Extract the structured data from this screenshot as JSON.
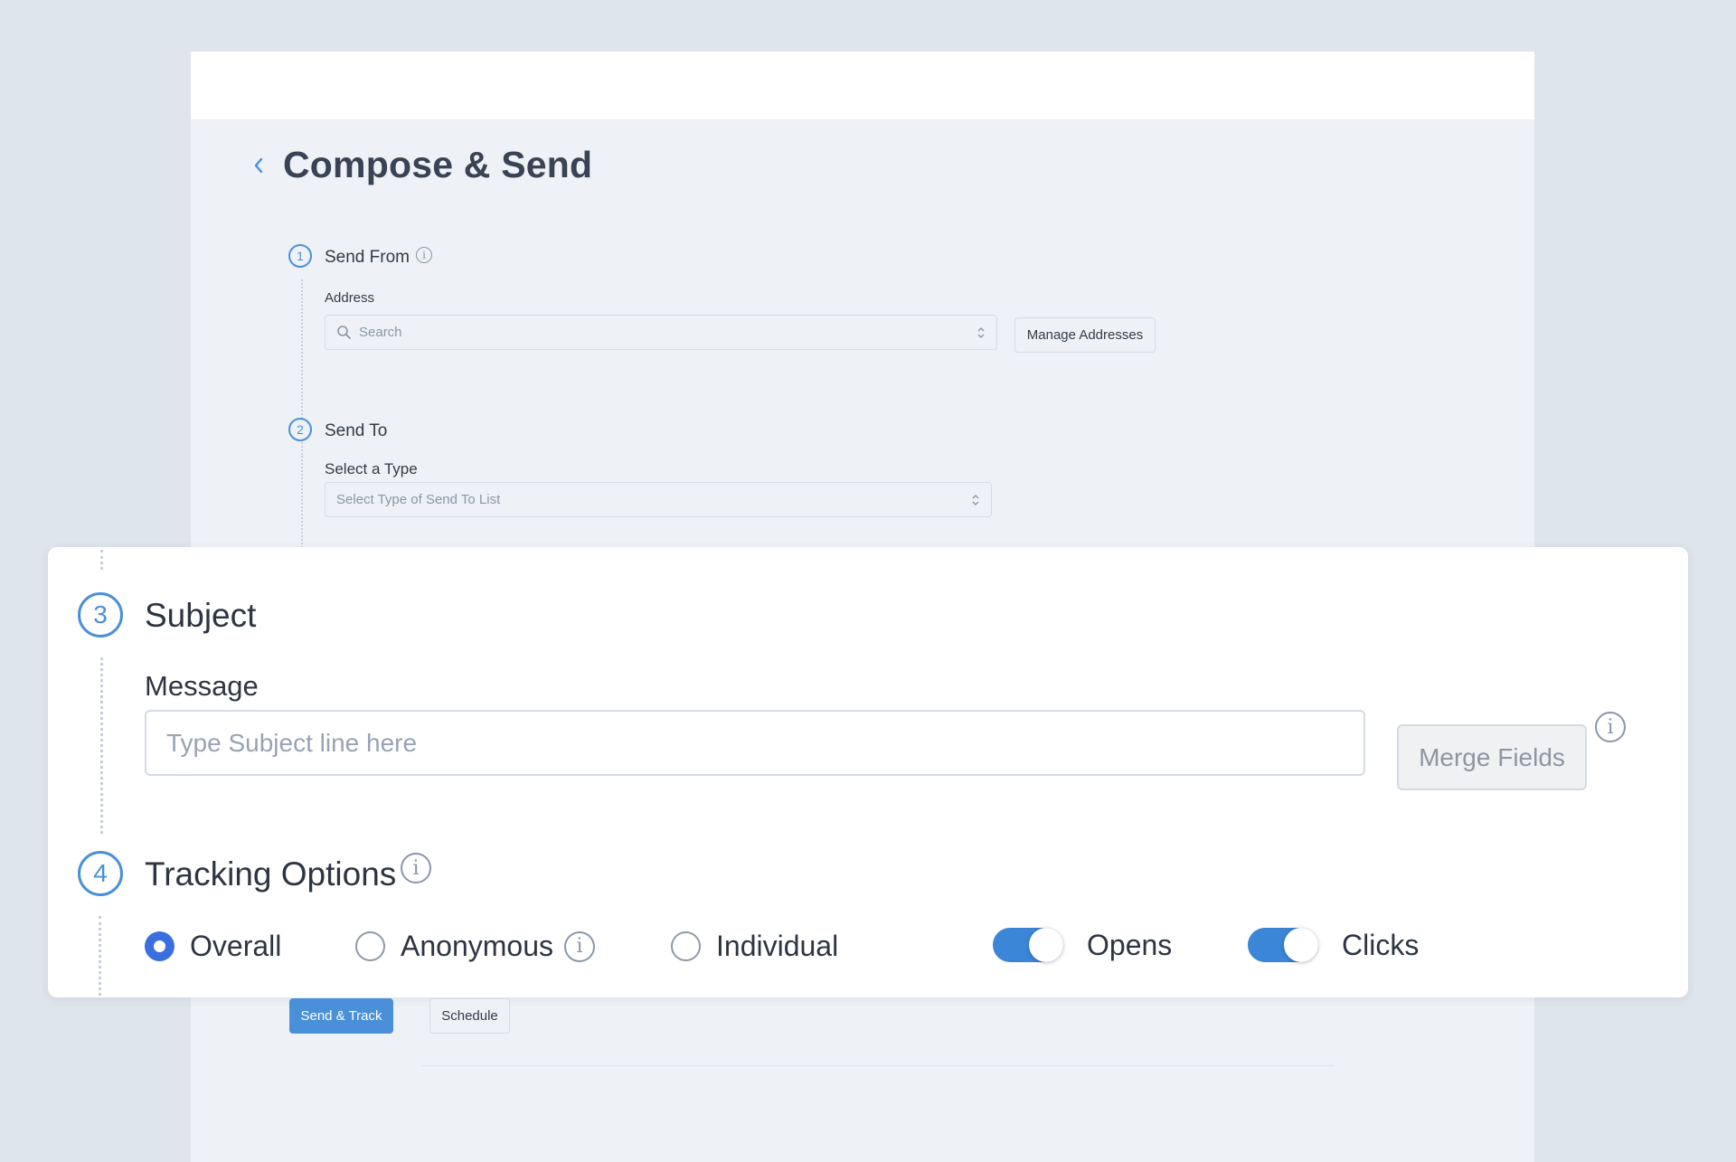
{
  "header": {
    "title": "Compose & Send"
  },
  "steps": {
    "send_from": {
      "number": "1",
      "title": "Send From",
      "address_label": "Address",
      "address_placeholder": "Search",
      "manage_button": "Manage Addresses"
    },
    "send_to": {
      "number": "2",
      "title": "Send To",
      "type_label": "Select a Type",
      "type_placeholder": "Select Type of Send To List"
    },
    "subject": {
      "number": "3",
      "title": "Subject",
      "message_label": "Message",
      "input_placeholder": "Type Subject line here",
      "input_value": "",
      "merge_button": "Merge Fields"
    },
    "tracking": {
      "number": "4",
      "title": "Tracking Options",
      "radios": [
        {
          "label": "Overall",
          "checked": true
        },
        {
          "label": "Anonymous",
          "checked": false
        },
        {
          "label": "Individual",
          "checked": false
        }
      ],
      "toggles": [
        {
          "label": "Opens",
          "on": true
        },
        {
          "label": "Clicks",
          "on": true
        }
      ]
    }
  },
  "actions": {
    "send_track": "Send & Track",
    "schedule": "Schedule"
  },
  "icons": {
    "back": "chevron-left-icon",
    "info": "info-icon",
    "search": "search-icon",
    "select_arrows": "chevron-up-down-icon"
  },
  "colors": {
    "accent": "#4a90d9",
    "radio_selected": "#3a6fe0",
    "toggle_on": "#3b86d6",
    "page_bg": "#dfe5ec",
    "panel_bg": "#eef2f7"
  }
}
